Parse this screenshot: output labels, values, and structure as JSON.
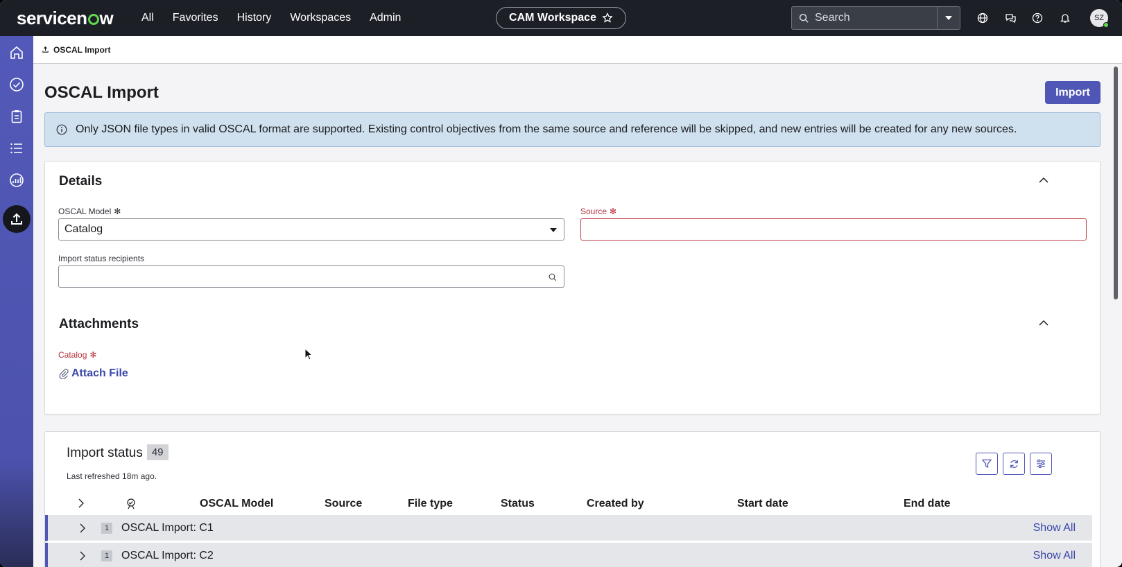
{
  "topnav": {
    "brand": "servicenow",
    "links": [
      "All",
      "Favorites",
      "History",
      "Workspaces",
      "Admin"
    ],
    "workspace": "CAM Workspace",
    "search_placeholder": "Search",
    "avatar_initials": "SZ"
  },
  "breadcrumb": {
    "label": "OSCAL Import"
  },
  "page": {
    "title": "OSCAL Import",
    "import_label": "Import",
    "info": "Only JSON file types in valid OSCAL format are supported. Existing control objectives from the same source and reference will be skipped, and new entries will be created for any new sources."
  },
  "details": {
    "title": "Details",
    "oscal_model_label": "OSCAL Model",
    "oscal_model_value": "Catalog",
    "source_label": "Source",
    "recipients_label": "Import status recipients"
  },
  "attachments": {
    "title": "Attachments",
    "catalog_label": "Catalog",
    "attach_label": "Attach File"
  },
  "import_status": {
    "title": "Import status",
    "count": "49",
    "last_refreshed": "Last refreshed 18m ago.",
    "columns": [
      "OSCAL Model",
      "Source",
      "File type",
      "Status",
      "Created by",
      "Start date",
      "End date"
    ],
    "groups": [
      {
        "count": "1",
        "name": "OSCAL Import: C1",
        "action": "Show All"
      },
      {
        "count": "1",
        "name": "OSCAL Import: C2",
        "action": "Show All"
      }
    ]
  },
  "colors": {
    "nav_bg": "#1c1f26",
    "rail": "#5259b8",
    "accent": "#4f56b5",
    "info_bg": "#cfe0ee",
    "required": "#b5323c"
  }
}
